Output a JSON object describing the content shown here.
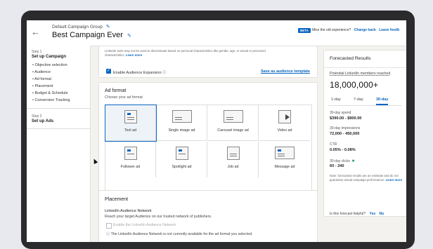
{
  "header": {
    "group": "Default Campaign Group",
    "campaign": "Best Campaign Ever",
    "beta": "BETA",
    "old_experience": "Miss the old experience?",
    "go_back": "Change back",
    "feedback": "Leave feedb"
  },
  "nav": {
    "step1_label": "Step 1",
    "step1_title": "Set up Campaign",
    "items": [
      "Objective selection",
      "Audience",
      "Ad format",
      "Placement",
      "Budget & Schedule",
      "Conversion Tracking"
    ],
    "step2_label": "Step 2",
    "step2_title": "Set up Ads"
  },
  "audience": {
    "disclaimer": "LinkedIn tools may not be used to discriminate based on personal characteristics like gender, age, or actual or perceived",
    "disclaimer2": "characteristics.",
    "learn_more": "Learn more",
    "expansion": "Enable Audience Expansion",
    "save_template": "Save as audience template"
  },
  "adformat": {
    "title": "Ad format",
    "subtitle": "Choose your ad format",
    "formats": [
      "Text ad",
      "Single image ad",
      "Carousel image ad",
      "Video ad",
      "Follower ad",
      "Spotlight ad",
      "Job ad",
      "Message ad"
    ]
  },
  "placement": {
    "title": "Placement",
    "network": "LinkedIn Audience Network",
    "network_desc": "Reach your target Audience on our trusted network of publishers.",
    "enable_label": "Enable the LinkedIn Audience Network",
    "note": "The LinkedIn Audience Network is not currently available for the ad format you selected."
  },
  "forecast": {
    "title": "Forecasted Results",
    "potential_label": "Potential LinkedIn members reached",
    "potential_value": "18,000,000+",
    "tabs": [
      "1-day",
      "7-day",
      "30-day"
    ],
    "active_tab": "30-day",
    "spend_label": "30-day spend",
    "spend_value": "$390.00 - $900.00",
    "impressions_label": "30-day impressions",
    "impressions_value": "72,000 - 450,000",
    "ctr_label": "CTR",
    "ctr_value": "0.05% - 0.08%",
    "clicks_label": "30-day clicks",
    "clicks_value": "60 - 240",
    "note": "Note: forecasted results are an estimate and do not guarantee actual campaign performance.",
    "note_link": "Learn more",
    "helpful": "Is this forecast helpful?",
    "yes": "Yes",
    "no": "No"
  }
}
